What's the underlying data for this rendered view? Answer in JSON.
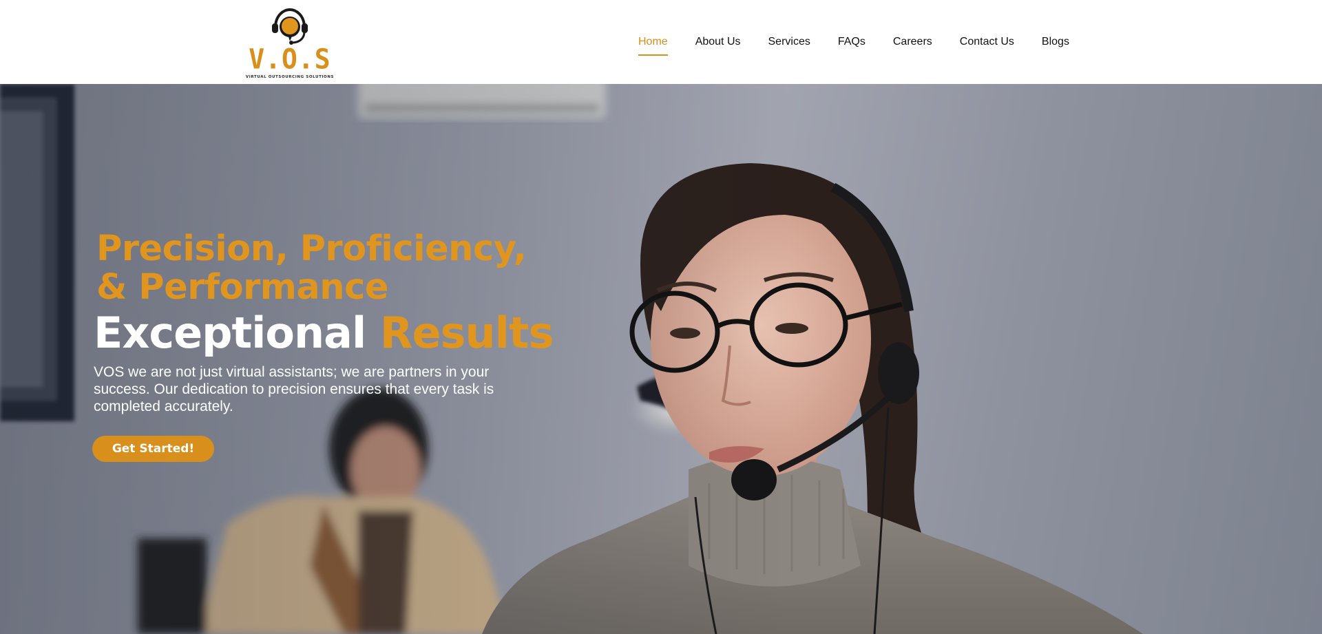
{
  "brand": {
    "name": "V.O.S",
    "tagline": "VIRTUAL OUTSOURCING SOLUTIONS",
    "logo_icon": "headset-chat-icon"
  },
  "nav": {
    "items": [
      {
        "label": "Home",
        "active": true
      },
      {
        "label": "About Us",
        "active": false
      },
      {
        "label": "Services",
        "active": false
      },
      {
        "label": "FAQs",
        "active": false
      },
      {
        "label": "Careers",
        "active": false
      },
      {
        "label": "Contact Us",
        "active": false
      },
      {
        "label": "Blogs",
        "active": false
      }
    ]
  },
  "hero": {
    "headline_line1": "Precision, Proficiency,",
    "headline_line2": "& Performance",
    "subheadline_white": "Exceptional",
    "subheadline_accent": "Results",
    "description": "VOS we are not just virtual assistants; we are partners in your success. Our dedication to precision ensures that every task is completed accurately.",
    "cta_label": "Get Started!"
  },
  "colors": {
    "accent": "#d98f1c",
    "headline_accent": "#e0951f",
    "nav_text": "#111111",
    "header_bg": "#ffffff"
  }
}
